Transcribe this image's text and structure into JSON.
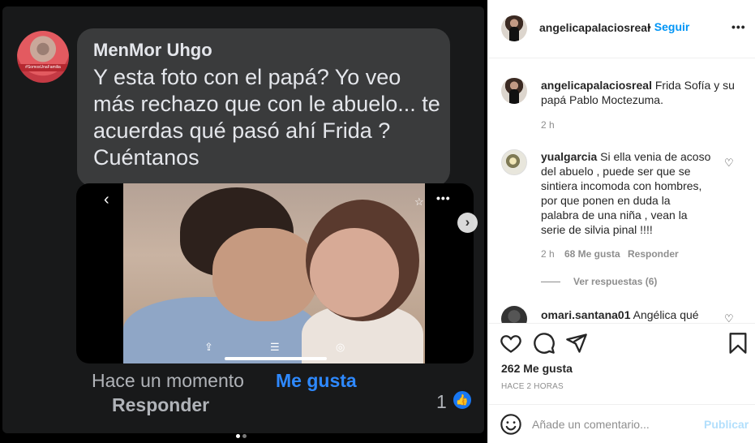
{
  "post_image": {
    "fb_comment": {
      "author": "MenMor Uhgo",
      "avatar_caption": "#SomosUnaFamilia",
      "text": "Y esta foto con el papá? Yo veo más rechazo que con le abuelo... te acuerdas qué pasó ahí Frida ? Cuéntanos",
      "time": "Hace un momento",
      "like_label": "Me gusta",
      "reply_label": "Responder",
      "reaction_count": "1"
    },
    "photo_controls": {
      "back": "‹",
      "star": "☆",
      "more": "•••",
      "share": "⇪",
      "adjust": "☰",
      "scan": "◎"
    },
    "carousel": {
      "next": "›",
      "dots": 2,
      "active_dot": 0
    }
  },
  "header": {
    "username": "angelicapalaciosreal",
    "follow_label": "Seguir",
    "separator": "•",
    "options": "•••"
  },
  "caption": {
    "username": "angelicapalaciosreal",
    "text": "Frida Sofía y su papá Pablo Moctezuma.",
    "time": "2 h"
  },
  "comments": [
    {
      "username": "yualgarcia",
      "text": "Si ella venia de acoso del abuelo , puede ser que se sintiera incomoda con hombres, por que ponen en duda la palabra de una niña , vean la serie de silvia pinal !!!!",
      "time": "2 h",
      "likes": "68 Me gusta",
      "reply_label": "Responder",
      "view_replies": "Ver respuestas (6)"
    },
    {
      "username": "omari.santana01",
      "text": "Angélica qué"
    }
  ],
  "actions": {
    "likes": "262 Me gusta",
    "posted": "HACE 2 HORAS"
  },
  "add_comment": {
    "placeholder": "Añade un comentario...",
    "publish_label": "Publicar"
  },
  "colors": {
    "link_blue": "#0095f6",
    "fb_like_blue": "#2e89ff",
    "publish_disabled": "#b2dffc",
    "fb_bubble": "#3a3b3c",
    "fb_bg": "#18191a"
  }
}
